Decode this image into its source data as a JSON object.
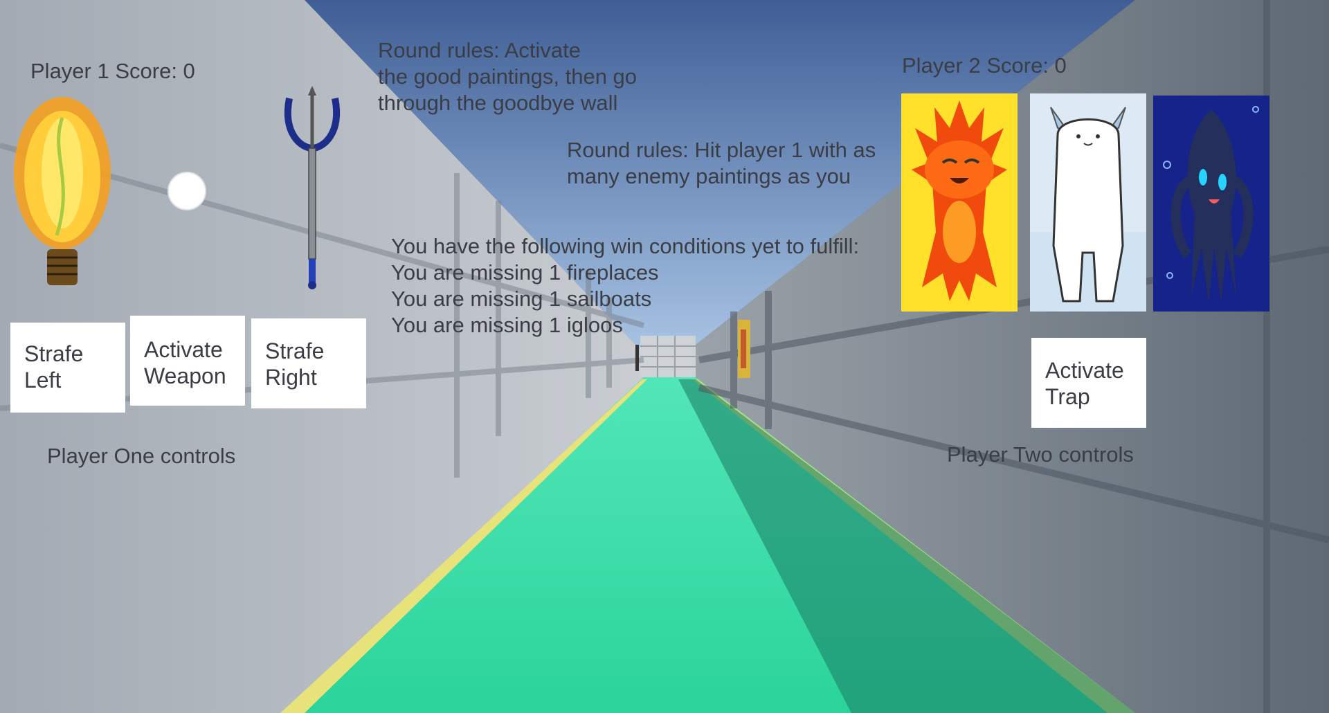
{
  "hud": {
    "player1_score": "Player 1 Score: 0",
    "player2_score": "Player 2 Score: 0",
    "round_rules_p1": [
      "Round rules: Activate",
      "the good paintings, then go",
      "through the goodbye wall"
    ],
    "round_rules_p2": [
      "Round rules: Hit player 1 with as",
      "many enemy paintings as you"
    ],
    "win_conditions": [
      "You have the following win conditions yet to fulfill:",
      "You are missing 1 fireplaces",
      "You are missing 1 sailboats",
      "You are missing 1 igloos"
    ],
    "player1_controls_label": "Player One controls",
    "player2_controls_label": "Player Two controls"
  },
  "player1": {
    "weapons": [
      "flame-sword-icon",
      "snowball-icon",
      "trident-icon"
    ],
    "buttons": {
      "strafe_left": "Strafe\nLeft",
      "activate_weapon": "Activate\nWeapon",
      "strafe_right": "Strafe\nRight"
    }
  },
  "player2": {
    "paintings": [
      "fire-creature-painting",
      "snow-creature-painting",
      "water-squid-painting"
    ],
    "buttons": {
      "activate_trap": "Activate\nTrap"
    }
  },
  "colors": {
    "top_bar": "#cc2229",
    "sky": "#5b7fb8",
    "floor": "#2fd8a0",
    "floor_edge": "#e8e070",
    "wall_left": "#9aa2ac",
    "wall_right": "#727d88"
  }
}
